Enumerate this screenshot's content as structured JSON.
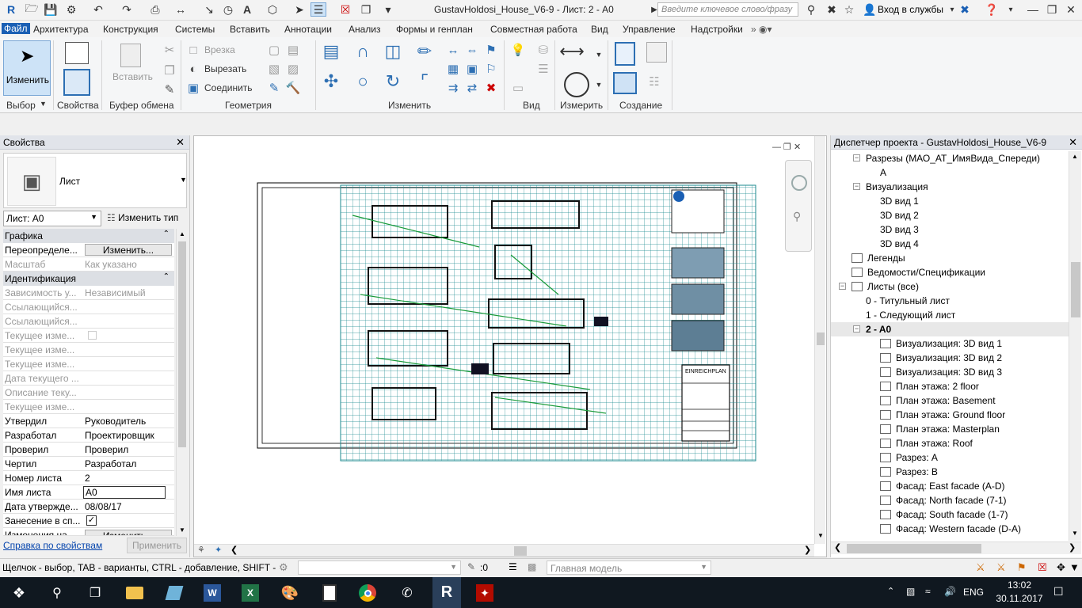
{
  "window": {
    "title": "GustavHoldosi_House_V6-9 - Лист: 2 - A0",
    "search_placeholder": "Введите ключевое слово/фразу",
    "signin": "Вход в службы"
  },
  "menu": [
    "Файл",
    "Архитектура",
    "Конструкция",
    "Системы",
    "Вставить",
    "Аннотации",
    "Анализ",
    "Формы и генплан",
    "Совместная работа",
    "Вид",
    "Управление",
    "Надстройки"
  ],
  "ribbon": {
    "modify_label": "Изменить",
    "panels": [
      "Выбор",
      "Свойства",
      "Буфер обмена",
      "Геометрия",
      "Изменить",
      "Вид",
      "Измерить",
      "Создание"
    ],
    "paste_label": "Вставить",
    "cut_label": "Врезка",
    "cut2_label": "Вырезать",
    "join_label": "Соединить"
  },
  "properties": {
    "title": "Свойства",
    "type_name": "Лист",
    "instance_selector": "Лист: A0",
    "edit_type": "Изменить тип",
    "help_link": "Справка по свойствам",
    "apply_button": "Применить",
    "sections": {
      "graphics": "Графика",
      "identity": "Идентификация"
    },
    "rows": [
      {
        "k": "Переопределе...",
        "v": "Изменить...",
        "button": true
      },
      {
        "k": "Масштаб",
        "v": "Как указано",
        "dis": true
      },
      {
        "k": "Зависимость у...",
        "v": "Независимый",
        "dis": true
      },
      {
        "k": "Ссылающийся...",
        "v": "",
        "dis": true
      },
      {
        "k": "Ссылающийся...",
        "v": "",
        "dis": true
      },
      {
        "k": "Текущее изме...",
        "v": "",
        "dis": true,
        "check": true
      },
      {
        "k": "Текущее изме...",
        "v": "",
        "dis": true
      },
      {
        "k": "Текущее изме...",
        "v": "",
        "dis": true
      },
      {
        "k": "Дата текущего ...",
        "v": "",
        "dis": true
      },
      {
        "k": "Описание теку...",
        "v": "",
        "dis": true
      },
      {
        "k": "Текущее изме...",
        "v": "",
        "dis": true
      },
      {
        "k": "Утвердил",
        "v": "Руководитель"
      },
      {
        "k": "Разработал",
        "v": "Проектировщик"
      },
      {
        "k": "Проверил",
        "v": "Проверил"
      },
      {
        "k": "Чертил",
        "v": "Разработал"
      },
      {
        "k": "Номер листа",
        "v": "2"
      },
      {
        "k": "Имя листа",
        "v": "A0",
        "edit": true
      },
      {
        "k": "Дата утвержде...",
        "v": "08/08/17"
      },
      {
        "k": "Занесение в сп...",
        "v": "",
        "checked": true
      },
      {
        "k": "Изменения на ...",
        "v": "Изменить...",
        "button": true
      }
    ]
  },
  "sheet": {
    "title_block": "EINREICHPLAN"
  },
  "browser": {
    "title": "Диспетчер проекта - GustavHoldosi_House_V6-9",
    "items": [
      {
        "label": "Разрезы (МАО_АТ_ИмяВида_Спереди)",
        "level": 1,
        "tog": "−"
      },
      {
        "label": "A",
        "level": 2
      },
      {
        "label": "Визуализация",
        "level": 1,
        "tog": "−"
      },
      {
        "label": "3D вид 1",
        "level": 2
      },
      {
        "label": "3D вид 2",
        "level": 2
      },
      {
        "label": "3D вид 3",
        "level": 2
      },
      {
        "label": "3D вид 4",
        "level": 2
      },
      {
        "label": "Легенды",
        "level": 0,
        "icon": true
      },
      {
        "label": "Ведомости/Спецификации",
        "level": 0,
        "icon": true
      },
      {
        "label": "Листы (все)",
        "level": 0,
        "icon": true,
        "tog": "−"
      },
      {
        "label": "0 - Титульный лист",
        "level": 1
      },
      {
        "label": "1 - Следующий лист",
        "level": 1
      },
      {
        "label": "2 - A0",
        "level": 1,
        "tog": "−",
        "bold": true
      },
      {
        "label": "Визуализация: 3D вид 1",
        "level": 2,
        "icon": true
      },
      {
        "label": "Визуализация: 3D вид 2",
        "level": 2,
        "icon": true
      },
      {
        "label": "Визуализация: 3D вид 3",
        "level": 2,
        "icon": true
      },
      {
        "label": "План этажа: 2 floor",
        "level": 2,
        "icon": true
      },
      {
        "label": "План этажа: Basement",
        "level": 2,
        "icon": true
      },
      {
        "label": "План этажа: Ground floor",
        "level": 2,
        "icon": true
      },
      {
        "label": "План этажа: Masterplan",
        "level": 2,
        "icon": true
      },
      {
        "label": "План этажа: Roof",
        "level": 2,
        "icon": true
      },
      {
        "label": "Разрез: A",
        "level": 2,
        "icon": true
      },
      {
        "label": "Разрез: B",
        "level": 2,
        "icon": true
      },
      {
        "label": "Фасад: East facade (A-D)",
        "level": 2,
        "icon": true
      },
      {
        "label": "Фасад: North facade (7-1)",
        "level": 2,
        "icon": true
      },
      {
        "label": "Фасад: South facade (1-7)",
        "level": 2,
        "icon": true
      },
      {
        "label": "Фасад: Western facade (D-A)",
        "level": 2,
        "icon": true
      }
    ]
  },
  "status": {
    "hint": "Щелчок - выбор, TAB - варианты, CTRL - добавление, SHIFT - с",
    "count": ":0",
    "model": "Главная модель"
  },
  "taskbar": {
    "lang": "ENG",
    "time": "13:02",
    "date": "30.11.2017"
  }
}
